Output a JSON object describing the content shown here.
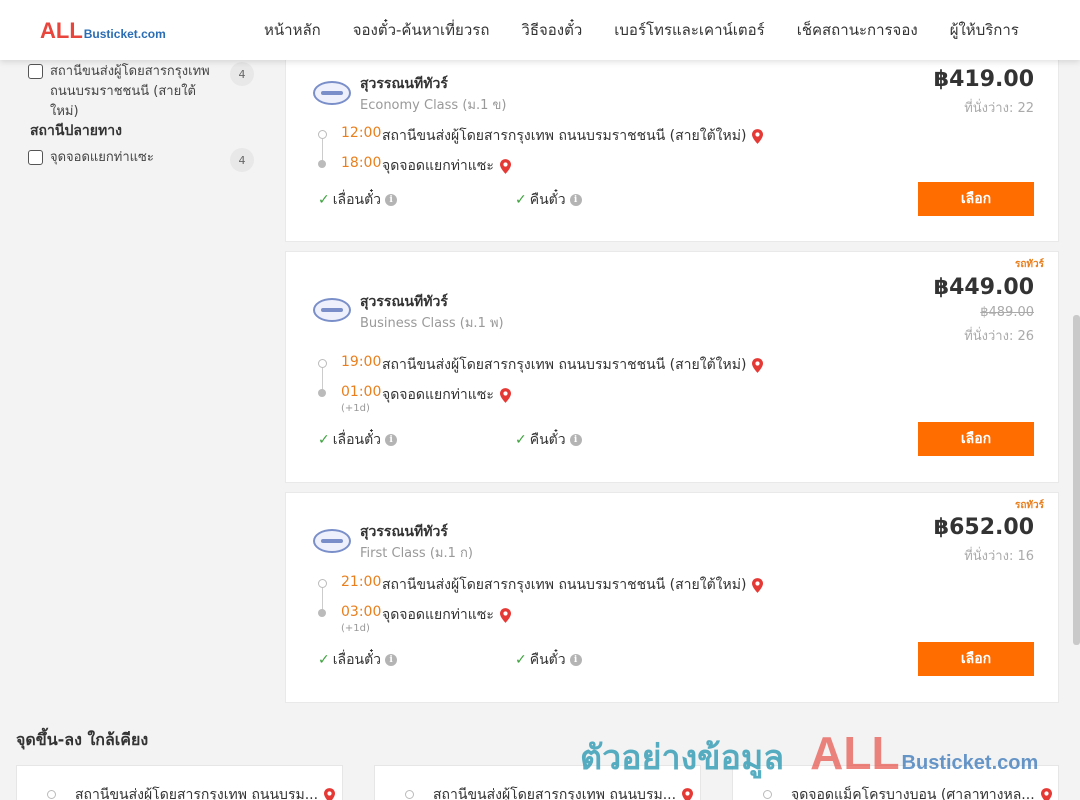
{
  "header": {
    "logo_all": "ALL",
    "logo_rest": "Busticket.com",
    "nav": [
      "หน้าหลัก",
      "จองตั๋ว-ค้นหาเที่ยวรถ",
      "วิธีจองตั๋ว",
      "เบอร์โทรและเคาน์เตอร์",
      "เช็คสถานะการจอง",
      "ผู้ให้บริการ"
    ]
  },
  "sidebar": {
    "origin_filter": {
      "label": "สถานีขนส่งผู้โดยสารกรุงเทพ ถนนบรมราชชนนี (สายใต้ใหม่)",
      "count": "4"
    },
    "destination_title": "สถานีปลายทาง",
    "destination_filter": {
      "label": "จุดจอดแยกท่าแซะ",
      "count": "4"
    }
  },
  "trips": [
    {
      "operator": "สุวรรณนทีทัวร์",
      "class": "Economy Class (ม.1 ข)",
      "price": "฿419.00",
      "seats": "ที่นั่งว่าง: 22",
      "depart_time": "12:00",
      "depart_place": "สถานีขนส่งผู้โดยสารกรุงเทพ ถนนบรมราชชนนี (สายใต้ใหม่)",
      "arrive_time": "18:00",
      "arrive_place": "จุดจอดแยกท่าแซะ",
      "feature1": "เลื่อนตั๋ว",
      "feature2": "คืนตั๋ว",
      "button": "เลือก"
    },
    {
      "promo": "รถทัวร์",
      "operator": "สุวรรณนทีทัวร์",
      "class": "Business Class (ม.1 พ)",
      "price": "฿449.00",
      "old_price": "฿489.00",
      "seats": "ที่นั่งว่าง: 26",
      "depart_time": "19:00",
      "depart_place": "สถานีขนส่งผู้โดยสารกรุงเทพ ถนนบรมราชชนนี (สายใต้ใหม่)",
      "arrive_time": "01:00",
      "arrive_note": "(+1d)",
      "arrive_place": "จุดจอดแยกท่าแซะ",
      "feature1": "เลื่อนตั๋ว",
      "feature2": "คืนตั๋ว",
      "button": "เลือก"
    },
    {
      "promo": "รถทัวร์",
      "operator": "สุวรรณนทีทัวร์",
      "class": "First Class (ม.1 ก)",
      "price": "฿652.00",
      "seats": "ที่นั่งว่าง: 16",
      "depart_time": "21:00",
      "depart_place": "สถานีขนส่งผู้โดยสารกรุงเทพ ถนนบรมราชชนนี (สายใต้ใหม่)",
      "arrive_time": "03:00",
      "arrive_note": "(+1d)",
      "arrive_place": "จุดจอดแยกท่าแซะ",
      "feature1": "เลื่อนตั๋ว",
      "feature2": "คืนตั๋ว",
      "button": "เลือก"
    }
  ],
  "nearby": {
    "title": "จุดขึ้น-ลง ใกล้เคียง",
    "items": [
      "สถานีขนส่งผู้โดยสารกรุงเทพ ถนนบรม...",
      "สถานีขนส่งผู้โดยสารกรุงเทพ ถนนบรม...",
      "จุดจอดแม็คโครบางบอน (ศาลาทางหล..."
    ]
  },
  "watermark": {
    "thai": "ตัวอย่างข้อมูล",
    "all": "ALL",
    "rest": "Busticket.com"
  },
  "colors": {
    "accent": "#ff6c00",
    "time": "#e97f1d",
    "logo_red": "#e8453c",
    "logo_blue": "#2a6db5"
  }
}
